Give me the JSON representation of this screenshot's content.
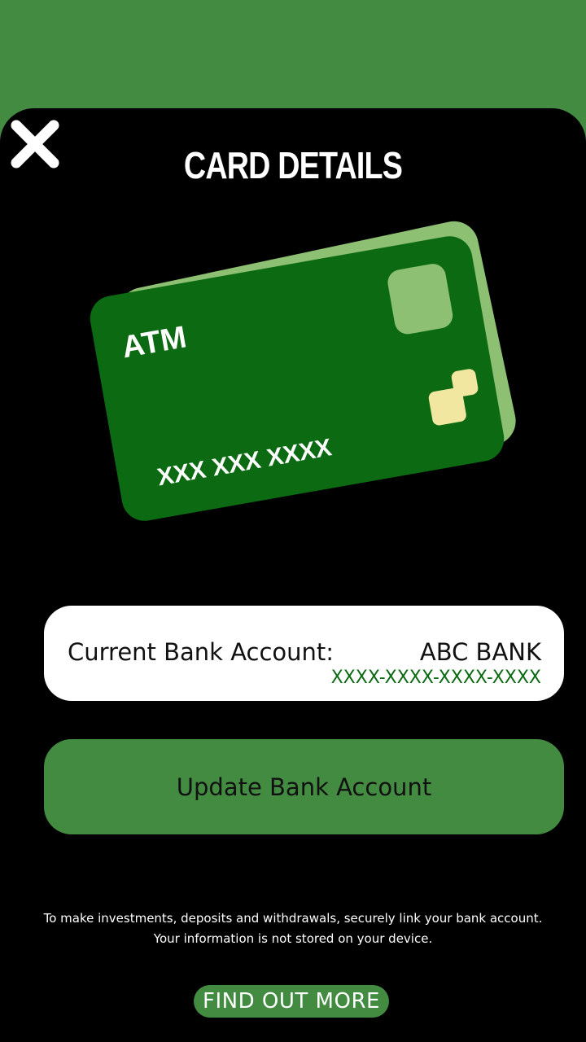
{
  "header": {
    "title": "CARD DETAILS"
  },
  "card": {
    "type_label": "ATM",
    "number_mask": "XXX XXX XXXX"
  },
  "account": {
    "label": "Current Bank Account:",
    "bank_name": "ABC BANK",
    "account_number": "XXXX-XXXX-XXXX-XXXX"
  },
  "actions": {
    "update_label": "Update Bank Account",
    "find_out_label": "FIND OUT MORE"
  },
  "info": {
    "line1": "To make investments, deposits and withdrawals, securely link your bank account.",
    "line2": "Your information is not stored on your device."
  },
  "icons": {
    "close": "close-icon"
  },
  "colors": {
    "accent_green": "#428b41",
    "card_green": "#0b6a12",
    "card_back": "#8ec073",
    "chip": "#f2e7a0",
    "background": "#000000"
  }
}
